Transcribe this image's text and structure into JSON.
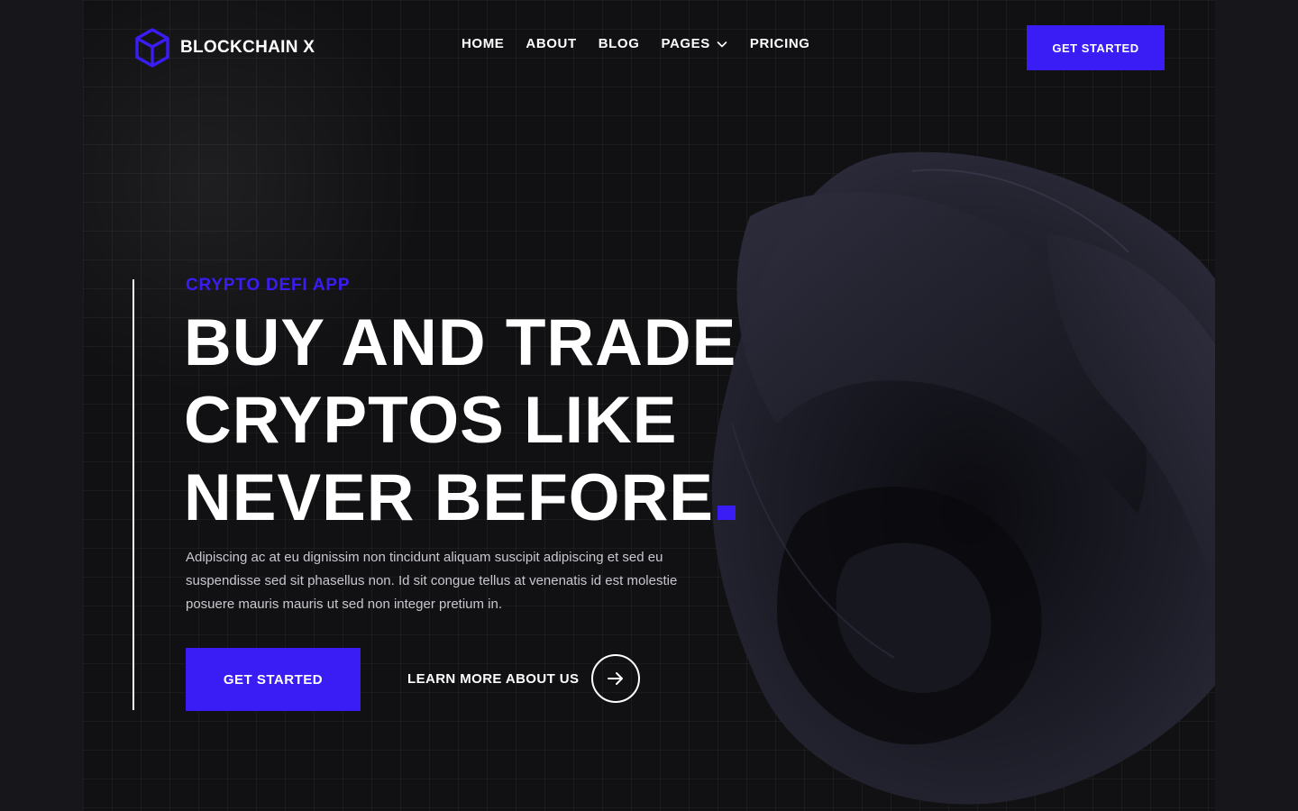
{
  "brand": {
    "name": "BLOCKCHAIN X",
    "icon": "cube-logo-icon",
    "accent_color": "#3a1cf5"
  },
  "nav": {
    "items": [
      {
        "label": "HOME"
      },
      {
        "label": "ABOUT"
      },
      {
        "label": "BLOG"
      },
      {
        "label": "PAGES"
      },
      {
        "label": "PRICING"
      }
    ],
    "cta_label": "GET STARTED"
  },
  "hero": {
    "eyebrow": "CRYPTO DEFI APP",
    "headline_lines": [
      "BUY AND TRADE",
      "CRYPTOS LIKE",
      "NEVER BEFORE"
    ],
    "description": "Adipiscing ac at eu dignissim non tincidunt aliquam suscipit adipiscing et sed eu suspendisse sed sit phasellus non. Id sit congue tellus at venenatis id est molestie posuere mauris mauris ut sed non integer pretium in.",
    "primary_button": "GET STARTED",
    "secondary_link": "LEARN MORE ABOUT US",
    "secondary_icon": "arrow-right-icon"
  }
}
